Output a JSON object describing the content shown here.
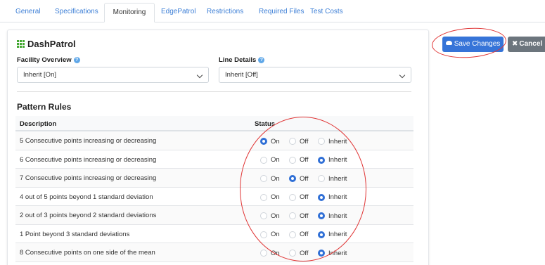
{
  "tabs": [
    {
      "label": "General",
      "active": false
    },
    {
      "label": "Specifications",
      "active": false
    },
    {
      "label": "Monitoring",
      "active": true
    },
    {
      "label": "EdgePatrol",
      "active": false
    },
    {
      "label": "Restrictions",
      "active": false
    },
    {
      "label": "Required Files",
      "active": false
    },
    {
      "label": "Test Costs",
      "active": false
    }
  ],
  "panel": {
    "title": "DashPatrol",
    "icon": "grid-icon",
    "facility_overview": {
      "label": "Facility Overview",
      "value": "Inherit [On]"
    },
    "line_details": {
      "label": "Line Details",
      "value": "Inherit [Off]"
    },
    "pattern_rules": {
      "title": "Pattern Rules",
      "columns": [
        "Description",
        "Status"
      ],
      "options": [
        "On",
        "Off",
        "Inherit"
      ],
      "rows": [
        {
          "description": "5 Consecutive points increasing or decreasing",
          "selected": "On"
        },
        {
          "description": "6 Consecutive points increasing or decreasing",
          "selected": "Inherit"
        },
        {
          "description": "7 Consecutive points increasing or decreasing",
          "selected": "Off"
        },
        {
          "description": "4 out of 5 points beyond 1 standard deviation",
          "selected": "Inherit"
        },
        {
          "description": "2 out of 3 points beyond 2 standard deviations",
          "selected": "Inherit"
        },
        {
          "description": "1 Point beyond 3 standard deviations",
          "selected": "Inherit"
        },
        {
          "description": "8 Consecutive points on one side of the mean",
          "selected": "Inherit"
        }
      ]
    }
  },
  "actions": {
    "save_label": "Save Changes",
    "cancel_label": "Cancel"
  },
  "colors": {
    "primary": "#3674d8",
    "secondary": "#6c757d",
    "link": "#3d7fd6",
    "annotation": "#e03535",
    "brand_icon": "#44a832"
  }
}
